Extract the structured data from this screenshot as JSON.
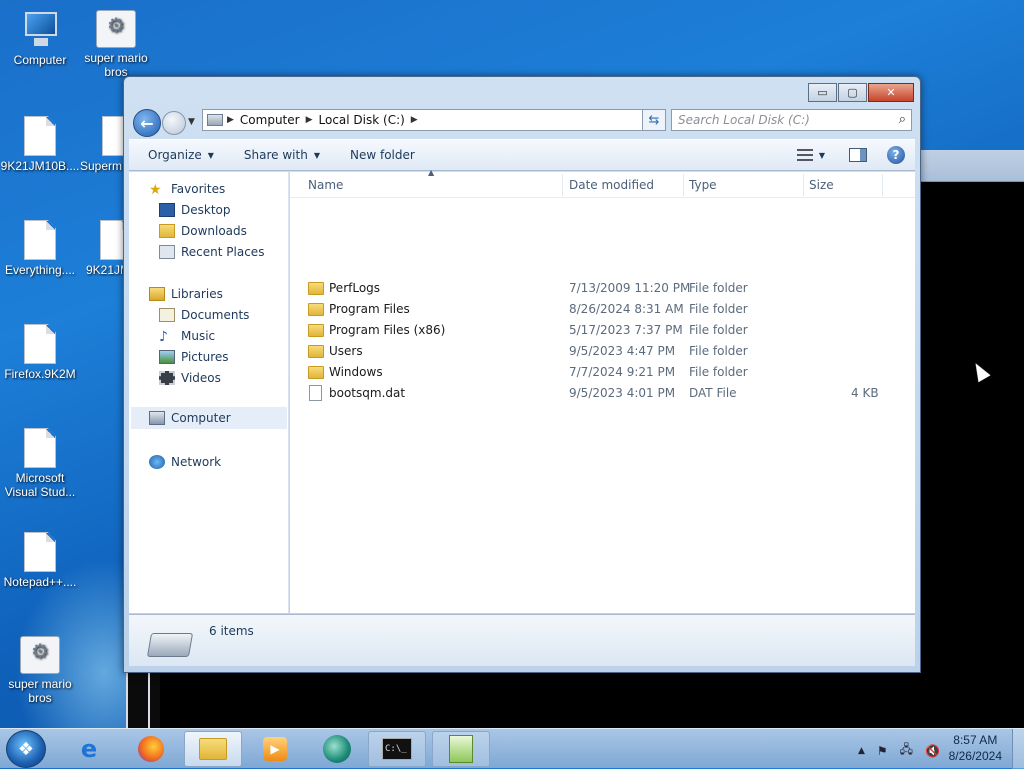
{
  "desktop": {
    "icons": [
      {
        "label": "Computer"
      },
      {
        "label": "super mario bros"
      },
      {
        "label": "9K21JM10B...."
      },
      {
        "label": "Superm"
      },
      {
        "label": "Everything...."
      },
      {
        "label": "9K21JM"
      },
      {
        "label": "Firefox.9K2M"
      },
      {
        "label": "Microsoft Visual Stud..."
      },
      {
        "label": "Notepad++...."
      },
      {
        "label": "super mario bros"
      }
    ]
  },
  "window": {
    "title_buttons": {
      "minimize": "▭",
      "maximize": "▢",
      "close": "✕"
    },
    "address": {
      "segments": [
        "Computer",
        "Local Disk (C:)"
      ]
    },
    "search": {
      "placeholder": "Search Local Disk (C:)"
    },
    "toolbar": {
      "organize": "Organize",
      "share_with": "Share with",
      "new_folder": "New folder"
    },
    "nav": {
      "favorites": "Favorites",
      "desktop": "Desktop",
      "downloads": "Downloads",
      "recent_places": "Recent Places",
      "libraries": "Libraries",
      "documents": "Documents",
      "music": "Music",
      "pictures": "Pictures",
      "videos": "Videos",
      "computer": "Computer",
      "network": "Network"
    },
    "columns": {
      "name": "Name",
      "date": "Date modified",
      "type": "Type",
      "size": "Size"
    },
    "files": [
      {
        "name": "PerfLogs",
        "date": "7/13/2009 11:20 PM",
        "type": "File folder",
        "size": ""
      },
      {
        "name": "Program Files",
        "date": "8/26/2024 8:31 AM",
        "type": "File folder",
        "size": ""
      },
      {
        "name": "Program Files (x86)",
        "date": "5/17/2023 7:37 PM",
        "type": "File folder",
        "size": ""
      },
      {
        "name": "Users",
        "date": "9/5/2023 4:47 PM",
        "type": "File folder",
        "size": ""
      },
      {
        "name": "Windows",
        "date": "7/7/2024 9:21 PM",
        "type": "File folder",
        "size": ""
      },
      {
        "name": "bootsqm.dat",
        "date": "9/5/2023 4:01 PM",
        "type": "DAT File",
        "size": "4 KB"
      }
    ],
    "status": {
      "items": "6 items"
    }
  },
  "taskbar": {
    "clock_time": "8:57 AM",
    "clock_date": "8/26/2024"
  }
}
